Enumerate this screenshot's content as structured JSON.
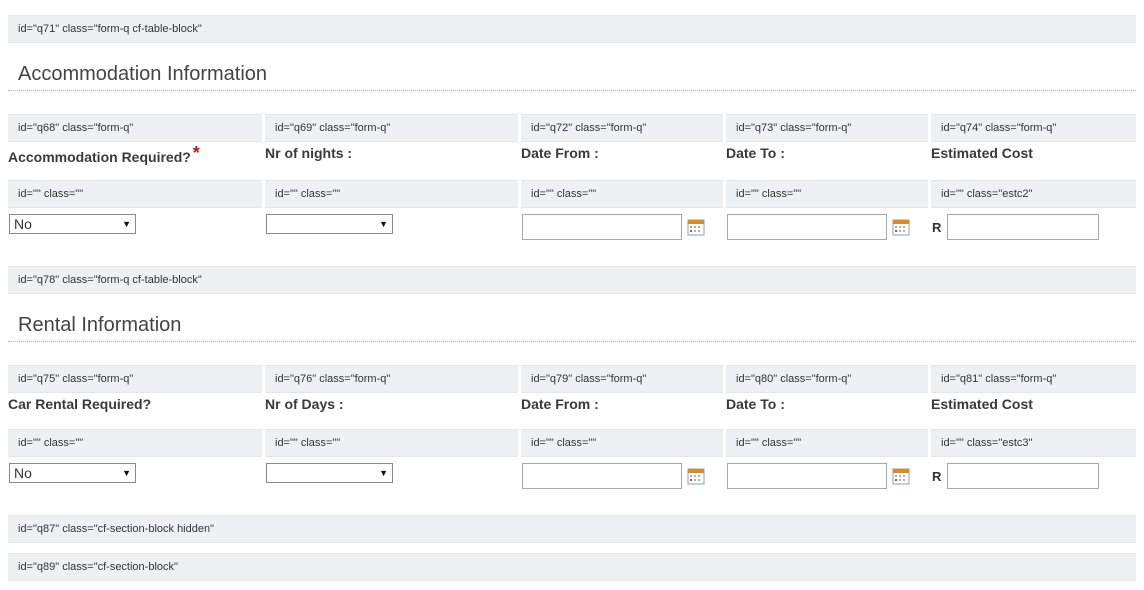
{
  "blocks": {
    "q71": "id=\"q71\" class=\"form-q cf-table-block\"",
    "q78": "id=\"q78\" class=\"form-q cf-table-block\"",
    "q87": "id=\"q87\" class=\"cf-section-block hidden\"",
    "q89": "id=\"q89\" class=\"cf-section-block\""
  },
  "accommodation": {
    "title": "Accommodation Information",
    "headers": [
      "id=\"q68\" class=\"form-q\"",
      "id=\"q69\" class=\"form-q\"",
      "id=\"q72\" class=\"form-q\"",
      "id=\"q73\" class=\"form-q\"",
      "id=\"q74\" class=\"form-q\""
    ],
    "labels": [
      "Accommodation Required?",
      "Nr of nights :",
      "Date From :",
      "Date To :",
      "Estimated Cost"
    ],
    "required_mark": "*",
    "sub_headers": [
      "id=\"\" class=\"\"",
      "id=\"\" class=\"\"",
      "id=\"\" class=\"\"",
      "id=\"\" class=\"\"",
      "id=\"\" class=\"estc2\""
    ],
    "required_value": "No",
    "nights_value": "",
    "date_from_value": "",
    "date_to_value": "",
    "currency": "R",
    "cost_value": ""
  },
  "rental": {
    "title": "Rental Information",
    "headers": [
      "id=\"q75\" class=\"form-q\"",
      "id=\"q76\" class=\"form-q\"",
      "id=\"q79\" class=\"form-q\"",
      "id=\"q80\" class=\"form-q\"",
      "id=\"q81\" class=\"form-q\""
    ],
    "labels": [
      "Car Rental Required?",
      "Nr of Days :",
      "Date From :",
      "Date To :",
      "Estimated Cost"
    ],
    "sub_headers": [
      "id=\"\" class=\"\"",
      "id=\"\" class=\"\"",
      "id=\"\" class=\"\"",
      "id=\"\" class=\"\"",
      "id=\"\" class=\"estc3\""
    ],
    "required_value": "No",
    "days_value": "",
    "date_from_value": "",
    "date_to_value": "",
    "currency": "R",
    "cost_value": ""
  },
  "icons": {
    "calendar": "calendar-icon",
    "dropdown": "chevron-down-icon"
  },
  "colors": {
    "debug_bar": "#eef1f4",
    "required": "#b01c1c",
    "calendar_accent": "#e08a1e"
  }
}
